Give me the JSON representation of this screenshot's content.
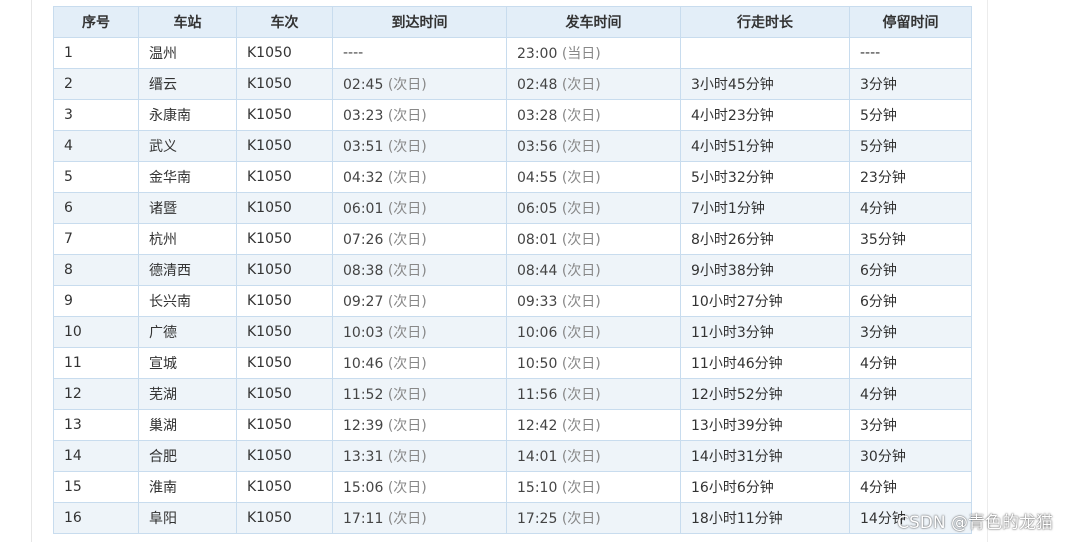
{
  "table": {
    "headers": [
      "序号",
      "车站",
      "车次",
      "到达时间",
      "发车时间",
      "行走时长",
      "停留时间"
    ],
    "rows": [
      {
        "no": "1",
        "station": "温州",
        "train": "K1050",
        "arrive": "----",
        "arrive_note": "",
        "depart": "23:00",
        "depart_note": "(当日)",
        "duration": "",
        "stop": "----"
      },
      {
        "no": "2",
        "station": "缙云",
        "train": "K1050",
        "arrive": "02:45",
        "arrive_note": "(次日)",
        "depart": "02:48",
        "depart_note": "(次日)",
        "duration": "3小时45分钟",
        "stop": "3分钟"
      },
      {
        "no": "3",
        "station": "永康南",
        "train": "K1050",
        "arrive": "03:23",
        "arrive_note": "(次日)",
        "depart": "03:28",
        "depart_note": "(次日)",
        "duration": "4小时23分钟",
        "stop": "5分钟"
      },
      {
        "no": "4",
        "station": "武义",
        "train": "K1050",
        "arrive": "03:51",
        "arrive_note": "(次日)",
        "depart": "03:56",
        "depart_note": "(次日)",
        "duration": "4小时51分钟",
        "stop": "5分钟"
      },
      {
        "no": "5",
        "station": "金华南",
        "train": "K1050",
        "arrive": "04:32",
        "arrive_note": "(次日)",
        "depart": "04:55",
        "depart_note": "(次日)",
        "duration": "5小时32分钟",
        "stop": "23分钟"
      },
      {
        "no": "6",
        "station": "诸暨",
        "train": "K1050",
        "arrive": "06:01",
        "arrive_note": "(次日)",
        "depart": "06:05",
        "depart_note": "(次日)",
        "duration": "7小时1分钟",
        "stop": "4分钟"
      },
      {
        "no": "7",
        "station": "杭州",
        "train": "K1050",
        "arrive": "07:26",
        "arrive_note": "(次日)",
        "depart": "08:01",
        "depart_note": "(次日)",
        "duration": "8小时26分钟",
        "stop": "35分钟"
      },
      {
        "no": "8",
        "station": "德清西",
        "train": "K1050",
        "arrive": "08:38",
        "arrive_note": "(次日)",
        "depart": "08:44",
        "depart_note": "(次日)",
        "duration": "9小时38分钟",
        "stop": "6分钟"
      },
      {
        "no": "9",
        "station": "长兴南",
        "train": "K1050",
        "arrive": "09:27",
        "arrive_note": "(次日)",
        "depart": "09:33",
        "depart_note": "(次日)",
        "duration": "10小时27分钟",
        "stop": "6分钟"
      },
      {
        "no": "10",
        "station": "广德",
        "train": "K1050",
        "arrive": "10:03",
        "arrive_note": "(次日)",
        "depart": "10:06",
        "depart_note": "(次日)",
        "duration": "11小时3分钟",
        "stop": "3分钟"
      },
      {
        "no": "11",
        "station": "宣城",
        "train": "K1050",
        "arrive": "10:46",
        "arrive_note": "(次日)",
        "depart": "10:50",
        "depart_note": "(次日)",
        "duration": "11小时46分钟",
        "stop": "4分钟"
      },
      {
        "no": "12",
        "station": "芜湖",
        "train": "K1050",
        "arrive": "11:52",
        "arrive_note": "(次日)",
        "depart": "11:56",
        "depart_note": "(次日)",
        "duration": "12小时52分钟",
        "stop": "4分钟"
      },
      {
        "no": "13",
        "station": "巢湖",
        "train": "K1050",
        "arrive": "12:39",
        "arrive_note": "(次日)",
        "depart": "12:42",
        "depart_note": "(次日)",
        "duration": "13小时39分钟",
        "stop": "3分钟"
      },
      {
        "no": "14",
        "station": "合肥",
        "train": "K1050",
        "arrive": "13:31",
        "arrive_note": "(次日)",
        "depart": "14:01",
        "depart_note": "(次日)",
        "duration": "14小时31分钟",
        "stop": "30分钟"
      },
      {
        "no": "15",
        "station": "淮南",
        "train": "K1050",
        "arrive": "15:06",
        "arrive_note": "(次日)",
        "depart": "15:10",
        "depart_note": "(次日)",
        "duration": "16小时6分钟",
        "stop": "4分钟"
      },
      {
        "no": "16",
        "station": "阜阳",
        "train": "K1050",
        "arrive": "17:11",
        "arrive_note": "(次日)",
        "depart": "17:25",
        "depart_note": "(次日)",
        "duration": "18小时11分钟",
        "stop": "14分钟"
      }
    ]
  },
  "watermark": "CSDN @青色的龙猫",
  "colors": {
    "header_bg": "#e3eef8",
    "border": "#c8dcee",
    "stripe": "#eef4f9"
  }
}
